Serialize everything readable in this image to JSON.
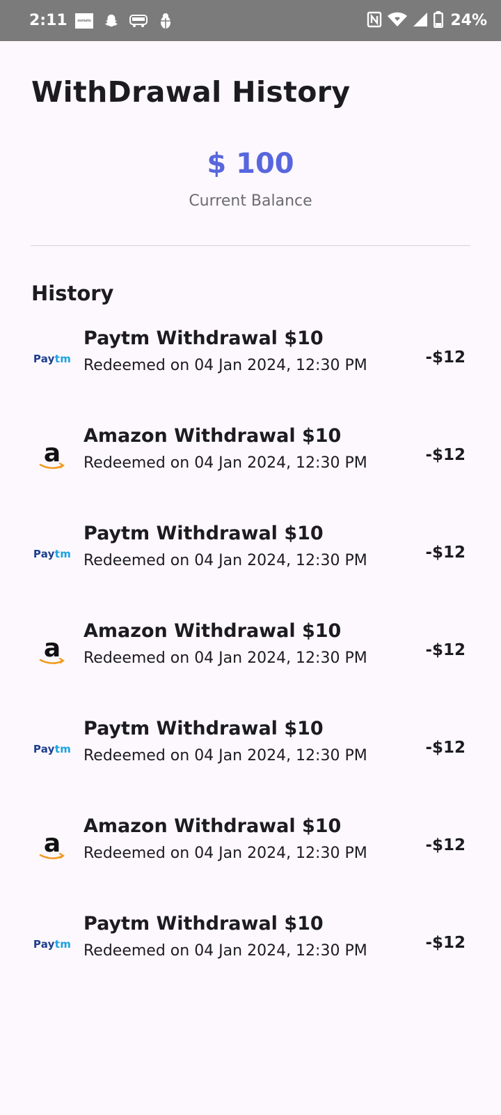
{
  "status_bar": {
    "time": "2:11",
    "battery": "24%",
    "notification_box_text": "zomato",
    "icons": [
      "zomato-icon",
      "snapchat-icon",
      "redbus-icon",
      "bug-icon",
      "nfc-icon",
      "wifi-icon",
      "signal-icon",
      "battery-icon"
    ]
  },
  "header": {
    "title": "WithDrawal History"
  },
  "balance": {
    "amount": "$ 100",
    "label": "Current Balance",
    "accent_color": "#5866dd"
  },
  "history": {
    "title": "History",
    "items": [
      {
        "provider": "paytm",
        "title": "Paytm Withdrawal $10",
        "subtitle": "Redeemed on 04 Jan 2024, 12:30 PM",
        "amount": "-$12"
      },
      {
        "provider": "amazon",
        "title": "Amazon Withdrawal $10",
        "subtitle": "Redeemed on 04 Jan 2024, 12:30 PM",
        "amount": "-$12"
      },
      {
        "provider": "paytm",
        "title": "Paytm Withdrawal $10",
        "subtitle": "Redeemed on 04 Jan 2024, 12:30 PM",
        "amount": "-$12"
      },
      {
        "provider": "amazon",
        "title": "Amazon Withdrawal $10",
        "subtitle": "Redeemed on 04 Jan 2024, 12:30 PM",
        "amount": "-$12"
      },
      {
        "provider": "paytm",
        "title": "Paytm Withdrawal $10",
        "subtitle": "Redeemed on 04 Jan 2024, 12:30 PM",
        "amount": "-$12"
      },
      {
        "provider": "amazon",
        "title": "Amazon Withdrawal $10",
        "subtitle": "Redeemed on 04 Jan 2024, 12:30 PM",
        "amount": "-$12"
      },
      {
        "provider": "paytm",
        "title": "Paytm Withdrawal $10",
        "subtitle": "Redeemed on 04 Jan 2024, 12:30 PM",
        "amount": "-$12"
      }
    ]
  },
  "logos": {
    "paytm_pay": "Pay",
    "paytm_tm": "tm",
    "amazon_letter": "a"
  }
}
